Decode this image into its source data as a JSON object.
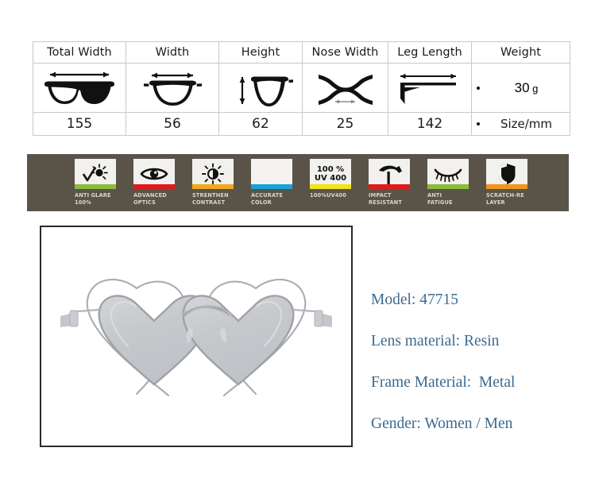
{
  "spec_table": {
    "headers": [
      "Total Width",
      "Width",
      "Height",
      "Nose Width",
      "Leg Length",
      "Weight"
    ],
    "icons": [
      "total-width-glasses-icon",
      "lens-width-icon",
      "lens-height-icon",
      "nose-width-icon",
      "leg-length-icon",
      "weight-bullet"
    ],
    "values": [
      "155",
      "56",
      "62",
      "25",
      "142"
    ],
    "weight_value": "30",
    "weight_unit": "g",
    "size_label": "Size/mm"
  },
  "feature_banner": {
    "background_color": "#5a5448",
    "features": [
      {
        "label": "ANTI GLARE\n100%",
        "icon": "sun-check-icon",
        "strip_color": "#8cbb3f"
      },
      {
        "label": "ADVANCED\nOPTICS",
        "icon": "eye-open-icon",
        "strip_color": "#e01b1b"
      },
      {
        "label": "STRENTHEN\nCONTRAST",
        "icon": "contrast-sun-icon",
        "strip_color": "#f0a81e"
      },
      {
        "label": "ACCURATE\nCOLOR",
        "icon": "color-gradient-icon",
        "strip_color": "#16a3d8"
      },
      {
        "label": "100%UV400",
        "icon": "uv400-text-icon",
        "strip_color": "#f2e31c",
        "text_line1": "100 %",
        "text_line2": "UV 400"
      },
      {
        "label": "IMPACT\nRESISTANT",
        "icon": "hammer-icon",
        "strip_color": "#e01b1b"
      },
      {
        "label": "ANTI\nFATIGUE",
        "icon": "eye-closed-lashes-icon",
        "strip_color": "#8cbb3f"
      },
      {
        "label": "SCRATCH-RE\nLAYER",
        "icon": "shield-icon",
        "strip_color": "#f0951e"
      }
    ]
  },
  "product_photo": {
    "name": "heart-shaped-sunglasses-photo",
    "frame_color": "#b9bcc0",
    "lens_color": "#c4c6ca"
  },
  "product_specs": {
    "accent_color": "#3d6a8f",
    "lines": [
      "Model: 47715",
      "Lens material: Resin",
      "Frame Material:  Metal",
      "Gender: Women / Men"
    ]
  }
}
